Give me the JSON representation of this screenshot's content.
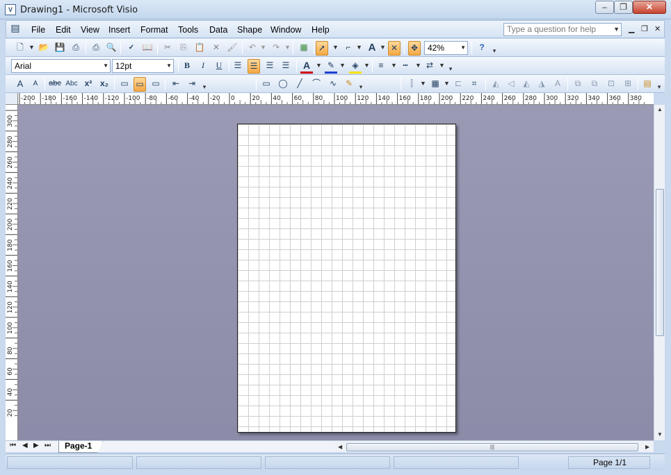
{
  "window": {
    "title": "Drawing1 - Microsoft Visio",
    "minimize": "‒",
    "restore": "❐",
    "close": "✕"
  },
  "menu": {
    "items": [
      "File",
      "Edit",
      "View",
      "Insert",
      "Format",
      "Tools",
      "Data",
      "Shape",
      "Window",
      "Help"
    ],
    "help_placeholder": "Type a question for help",
    "mdi_min": "▁",
    "mdi_restore": "❐",
    "mdi_close": "✕"
  },
  "standard_toolbar": {
    "zoom": "42%",
    "icons": [
      "new-icon",
      "open-icon",
      "save-icon",
      "permission-icon",
      "print-icon",
      "print-preview-icon",
      "spelling-icon",
      "research-icon",
      "cut-icon",
      "copy-icon",
      "paste-icon",
      "delete-icon",
      "format-painter-icon",
      "undo-icon",
      "redo-icon",
      "shapes-icon",
      "pointer-tool-icon",
      "connector-tool-icon",
      "text-tool-icon",
      "connection-point-tool-icon",
      "pan-zoom-icon",
      "help-icon"
    ]
  },
  "formatting_toolbar": {
    "font": "Arial",
    "size": "12pt",
    "bold": "B",
    "italic": "I",
    "underline": "U",
    "font_color": "A"
  },
  "format_text_toolbar": {
    "increase_font": "A",
    "decrease_font": "A",
    "strikethrough": "abc",
    "small_caps": "Abc",
    "superscript": "x²",
    "subscript": "x₂"
  },
  "ruler": {
    "horizontal": [
      "-200",
      "-180",
      "-160",
      "-140",
      "-120",
      "-100",
      "-80",
      "-60",
      "-40",
      "-20",
      "0",
      "20",
      "40",
      "60",
      "80",
      "100",
      "120",
      "140",
      "160",
      "180",
      "200",
      "220",
      "240",
      "260",
      "280",
      "300",
      "320",
      "340",
      "360",
      "380"
    ],
    "vertical": [
      "300",
      "280",
      "260",
      "240",
      "220",
      "200",
      "180",
      "160",
      "140",
      "120",
      "100",
      "80",
      "60",
      "40",
      "20"
    ]
  },
  "pages": {
    "tabs": [
      "Page-1"
    ],
    "active": "Page-1"
  },
  "status": {
    "page": "Page 1/1"
  },
  "colors": {
    "canvas": "#9595b2",
    "chrome": "#c9d9ee",
    "highlight": "#f5a844"
  }
}
